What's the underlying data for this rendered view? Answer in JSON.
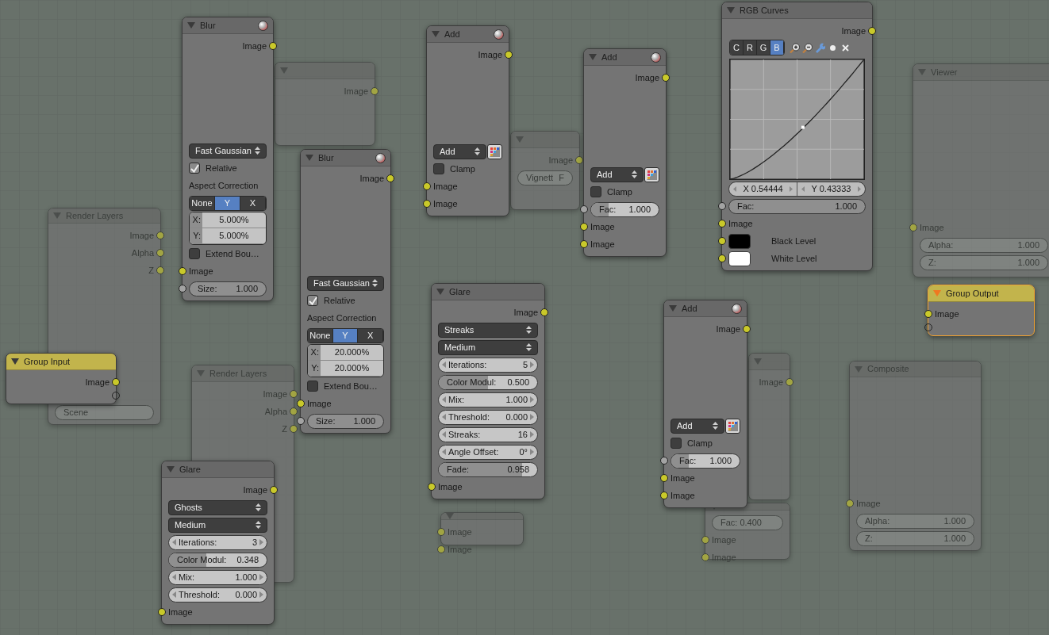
{
  "nodes": [
    {
      "title": "Blur",
      "kind": "default",
      "preview": true,
      "selected": false,
      "rows": [
        {
          "kind": "output",
          "label": "Image",
          "color": "#c9c92a"
        },
        {
          "kind": "dropdown",
          "label": "Fast Gaussian"
        },
        {
          "kind": "checkbox",
          "label": "Relative",
          "checked": true
        },
        {
          "kind": "label",
          "label": "Aspect Correction"
        },
        {
          "kind": "segmented",
          "options": [
            {
              "label": "None",
              "selected": false
            },
            {
              "label": "Y",
              "selected": true
            },
            {
              "label": "X",
              "selected": false
            }
          ]
        },
        {
          "kind": "vector",
          "items": [
            {
              "label": "X:",
              "value": "5.000%"
            },
            {
              "label": "Y:",
              "value": "5.000%"
            }
          ]
        },
        {
          "kind": "checkbox",
          "label": "Extend Bou…",
          "checked": false
        },
        {
          "kind": "input",
          "label": "Image",
          "color": "#c9c92a"
        },
        {
          "kind": "field",
          "label": "Size:",
          "value": "1.000",
          "color": "#a3a3a3"
        }
      ]
    },
    {
      "title": "Blur",
      "kind": "default",
      "preview": true,
      "selected": false,
      "rows": [
        {
          "kind": "output",
          "label": "Image",
          "color": "#c9c92a"
        },
        {
          "kind": "dropdown",
          "label": "Fast Gaussian"
        },
        {
          "kind": "checkbox",
          "label": "Relative",
          "checked": true
        },
        {
          "kind": "label",
          "label": "Aspect Correction"
        },
        {
          "kind": "segmented",
          "options": [
            {
              "label": "None",
              "selected": false
            },
            {
              "label": "Y",
              "selected": true
            },
            {
              "label": "X",
              "selected": false
            }
          ]
        },
        {
          "kind": "vector",
          "items": [
            {
              "label": "X:",
              "value": "20.000%"
            },
            {
              "label": "Y:",
              "value": "20.000%"
            }
          ]
        },
        {
          "kind": "checkbox",
          "label": "Extend Bou…",
          "checked": false
        },
        {
          "kind": "input",
          "label": "Image",
          "color": "#c9c92a"
        },
        {
          "kind": "field",
          "label": "Size:",
          "value": "1.000",
          "color": "#a3a3a3"
        }
      ]
    },
    {
      "title": "Add",
      "kind": "default",
      "preview": true,
      "selected": false,
      "rows": [
        {
          "kind": "output",
          "label": "Image",
          "color": "#c9c92a"
        },
        {
          "kind": "blend_dropdown",
          "label": "Add"
        },
        {
          "kind": "checkbox",
          "label": "Clamp",
          "checked": false
        },
        {
          "kind": "input",
          "label": "Image",
          "color": "#c9c92a"
        },
        {
          "kind": "input",
          "label": "Image",
          "color": "#c9c92a"
        }
      ]
    },
    {
      "title": "Add",
      "kind": "default",
      "preview": true,
      "selected": false,
      "rows": [
        {
          "kind": "output",
          "label": "Image",
          "color": "#c9c92a"
        },
        {
          "kind": "blend_dropdown",
          "label": "Add"
        },
        {
          "kind": "checkbox",
          "label": "Clamp",
          "checked": false
        },
        {
          "kind": "slider",
          "label": "Fac:",
          "value": "1.000",
          "level": 0.26,
          "color": "#a3a3a3"
        },
        {
          "kind": "input",
          "label": "Image",
          "color": "#c9c92a"
        },
        {
          "kind": "input",
          "label": "Image",
          "color": "#c9c92a"
        }
      ]
    },
    {
      "title": "RGB Curves",
      "kind": "default",
      "preview": false,
      "selected": false,
      "rows": [
        {
          "kind": "output",
          "label": "Image",
          "color": "#c9c92a"
        },
        {
          "kind": "curves",
          "channels": [
            {
              "label": "C",
              "selected": false
            },
            {
              "label": "R",
              "selected": false
            },
            {
              "label": "G",
              "selected": false
            },
            {
              "label": "B",
              "selected": true
            }
          ]
        },
        {
          "kind": "point",
          "x": "X 0.54444",
          "y": "Y 0.43333"
        },
        {
          "kind": "field",
          "label": "Fac:",
          "value": "1.000",
          "color": "#a3a3a3"
        },
        {
          "kind": "input",
          "label": "Image",
          "color": "#c9c92a"
        },
        {
          "kind": "color",
          "label": "Black Level",
          "color": "#000000"
        },
        {
          "kind": "color",
          "label": "White Level",
          "color": "#ffffff"
        }
      ]
    },
    {
      "title": "Glare",
      "kind": "default",
      "preview": false,
      "selected": false,
      "rows": [
        {
          "kind": "output",
          "label": "Image",
          "color": "#c9c92a"
        },
        {
          "kind": "dropdown",
          "label": "Streaks"
        },
        {
          "kind": "dropdown",
          "label": "Medium"
        },
        {
          "kind": "number",
          "label": "Iterations:",
          "value": "5"
        },
        {
          "kind": "slider",
          "label": "Color Modul:",
          "value": "0.500",
          "level": 0.5
        },
        {
          "kind": "number",
          "label": "Mix:",
          "value": "1.000"
        },
        {
          "kind": "number",
          "label": "Threshold:",
          "value": "0.000"
        },
        {
          "kind": "number",
          "label": "Streaks:",
          "value": "16"
        },
        {
          "kind": "number",
          "label": "Angle Offset:",
          "value": "0°"
        },
        {
          "kind": "slider",
          "label": "Fade:",
          "value": "0.958",
          "level": 0.85
        },
        {
          "kind": "input",
          "label": "Image",
          "color": "#c9c92a"
        }
      ]
    },
    {
      "title": "Add",
      "kind": "default",
      "preview": true,
      "selected": false,
      "rows": [
        {
          "kind": "output",
          "label": "Image",
          "color": "#c9c92a"
        },
        {
          "kind": "blend_dropdown",
          "label": "Add"
        },
        {
          "kind": "checkbox",
          "label": "Clamp",
          "checked": false
        },
        {
          "kind": "slider",
          "label": "Fac:",
          "value": "1.000",
          "level": 0.26,
          "color": "#a3a3a3"
        },
        {
          "kind": "input",
          "label": "Image",
          "color": "#c9c92a"
        },
        {
          "kind": "input",
          "label": "Image",
          "color": "#c9c92a"
        }
      ]
    },
    {
      "title": "Group Output",
      "kind": "group",
      "preview": false,
      "selected": true,
      "rows": [
        {
          "kind": "input",
          "label": "Image",
          "color": "#c9c92a"
        },
        {
          "kind": "empty_input"
        }
      ]
    },
    {
      "title": "Group Input",
      "kind": "group",
      "preview": false,
      "selected": false,
      "rows": [
        {
          "kind": "output",
          "label": "Image",
          "color": "#c9c92a"
        },
        {
          "kind": "empty_output"
        }
      ]
    },
    {
      "title": "Glare",
      "kind": "default",
      "preview": false,
      "selected": false,
      "rows": [
        {
          "kind": "output",
          "label": "Image",
          "color": "#c9c92a"
        },
        {
          "kind": "dropdown",
          "label": "Ghosts"
        },
        {
          "kind": "dropdown",
          "label": "Medium"
        },
        {
          "kind": "number",
          "label": "Iterations:",
          "value": "3"
        },
        {
          "kind": "slider",
          "label": "Color Modul:",
          "value": "0.348",
          "level": 0.38
        },
        {
          "kind": "number",
          "label": "Mix:",
          "value": "1.000"
        },
        {
          "kind": "number",
          "label": "Threshold:",
          "value": "0.000"
        },
        {
          "kind": "input",
          "label": "Image",
          "color": "#c9c92a"
        }
      ]
    }
  ],
  "background_nodes": [
    {
      "title": "Render Layers",
      "rows": [
        {
          "kind": "output",
          "label": "Image"
        },
        {
          "kind": "output",
          "label": "Alpha"
        },
        {
          "kind": "output",
          "label": "Z"
        },
        {
          "kind": "field",
          "label": "Scene"
        }
      ]
    },
    {
      "title": "Render Layers",
      "rows": [
        {
          "kind": "output",
          "label": "Image"
        },
        {
          "kind": "output",
          "label": "Alpha"
        },
        {
          "kind": "output",
          "label": "Z"
        }
      ]
    },
    {
      "rows": [
        {
          "kind": "output",
          "label": "Image"
        }
      ]
    },
    {
      "rows": [
        {
          "kind": "output",
          "label": "Image"
        },
        {
          "kind": "field",
          "label": "Vignett",
          "value": "F"
        }
      ]
    },
    {
      "title": "Viewer",
      "rows": [
        {
          "kind": "input",
          "label": "Image"
        },
        {
          "kind": "field",
          "label": "Alpha:",
          "value": "1.000"
        },
        {
          "kind": "field",
          "label": "Z:",
          "value": "1.000"
        }
      ]
    },
    {
      "title": "Composite",
      "rows": [
        {
          "kind": "input",
          "label": "Image"
        },
        {
          "kind": "field",
          "label": "Alpha:",
          "value": "1.000"
        },
        {
          "kind": "field",
          "label": "Z:",
          "value": "1.000"
        }
      ]
    },
    {
      "rows": [
        {
          "kind": "output",
          "label": "Image"
        }
      ]
    },
    {
      "rows": [
        {
          "kind": "input",
          "label": "Image"
        },
        {
          "kind": "input",
          "label": "Image"
        }
      ]
    },
    {
      "rows": [
        {
          "kind": "field",
          "label": "Fac: 0.400"
        },
        {
          "kind": "input",
          "label": "Image"
        },
        {
          "kind": "input",
          "label": "Image"
        }
      ]
    }
  ]
}
